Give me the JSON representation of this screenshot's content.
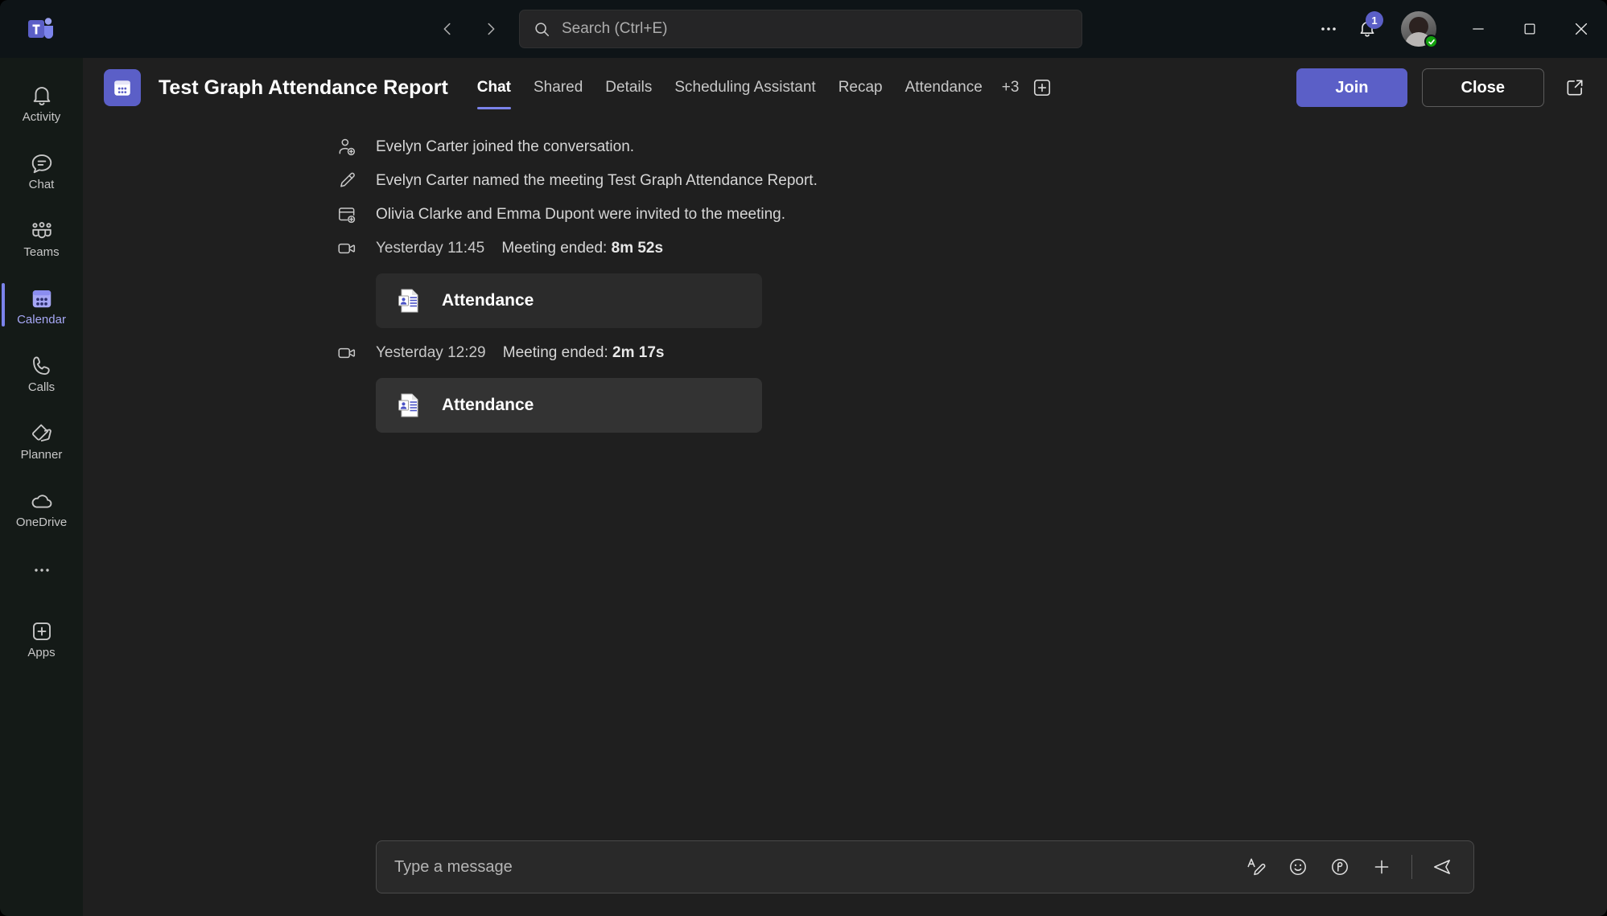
{
  "app": {
    "name": "Microsoft Teams",
    "logo_icon": "teams-logo-icon"
  },
  "titlebar": {
    "back_icon": "chevron-left-icon",
    "forward_icon": "chevron-right-icon",
    "search": {
      "icon": "search-icon",
      "placeholder": "Search (Ctrl+E)",
      "value": ""
    },
    "more_icon": "ellipsis-icon",
    "notifications": {
      "icon": "bell-icon",
      "badge": "1"
    },
    "avatar": {
      "name": "avatar",
      "presence": "available",
      "presence_icon": "checkmark-icon"
    },
    "window": {
      "minimize": "minimize-icon",
      "maximize": "maximize-icon",
      "close": "close-icon"
    }
  },
  "sidebar": {
    "items": [
      {
        "label": "Activity",
        "icon": "bell-icon",
        "active": false
      },
      {
        "label": "Chat",
        "icon": "chat-bubble-icon",
        "active": false
      },
      {
        "label": "Teams",
        "icon": "people-icon",
        "active": false
      },
      {
        "label": "Calendar",
        "icon": "calendar-icon",
        "active": true
      },
      {
        "label": "Calls",
        "icon": "phone-icon",
        "active": false
      },
      {
        "label": "Planner",
        "icon": "planner-icon",
        "active": false
      },
      {
        "label": "OneDrive",
        "icon": "cloud-icon",
        "active": false
      }
    ],
    "more_icon": "ellipsis-icon",
    "apps": {
      "label": "Apps",
      "icon": "plus-square-icon"
    }
  },
  "header": {
    "meeting_icon": "calendar-meeting-icon",
    "title": "Test Graph Attendance Report",
    "tabs": [
      {
        "label": "Chat",
        "active": true
      },
      {
        "label": "Shared",
        "active": false
      },
      {
        "label": "Details",
        "active": false
      },
      {
        "label": "Scheduling Assistant",
        "active": false
      },
      {
        "label": "Recap",
        "active": false
      },
      {
        "label": "Attendance",
        "active": false
      }
    ],
    "overflow_tabs": "+3",
    "add_tab_icon": "plus-square-icon",
    "join_label": "Join",
    "close_label": "Close",
    "popout_icon": "open-in-new-icon"
  },
  "chat": {
    "system_messages": [
      {
        "icon": "person-add-icon",
        "text": "Evelyn Carter joined the conversation."
      },
      {
        "icon": "pencil-icon",
        "text": "Evelyn Carter named the meeting Test Graph Attendance Report."
      },
      {
        "icon": "calendar-add-icon",
        "text": "Olivia Clarke and Emma Dupont were invited to the meeting."
      }
    ],
    "meeting_events": [
      {
        "icon": "video-icon",
        "time": "Yesterday 11:45",
        "label": "Meeting ended:",
        "duration": "8m 52s",
        "card": {
          "icon": "attendance-report-icon",
          "name": "Attendance",
          "hover": false
        }
      },
      {
        "icon": "video-icon",
        "time": "Yesterday 12:29",
        "label": "Meeting ended:",
        "duration": "2m 17s",
        "card": {
          "icon": "attendance-report-icon",
          "name": "Attendance",
          "hover": true
        }
      }
    ]
  },
  "compose": {
    "placeholder": "Type a message",
    "value": "",
    "tools": [
      {
        "icon": "format-text-icon",
        "name": "format-button"
      },
      {
        "icon": "emoji-icon",
        "name": "emoji-button"
      },
      {
        "icon": "loop-icon",
        "name": "loop-button"
      },
      {
        "icon": "plus-icon",
        "name": "attach-button"
      }
    ],
    "send_icon": "send-icon"
  },
  "colors": {
    "accent": "#5b5fc7",
    "accent_light": "#7b83eb",
    "titlebar_bg": "#0e1417",
    "rail_bg": "#141a17",
    "content_bg": "#1f1f1f",
    "card_bg": "#2b2b2b",
    "presence_green": "#13a10e"
  }
}
